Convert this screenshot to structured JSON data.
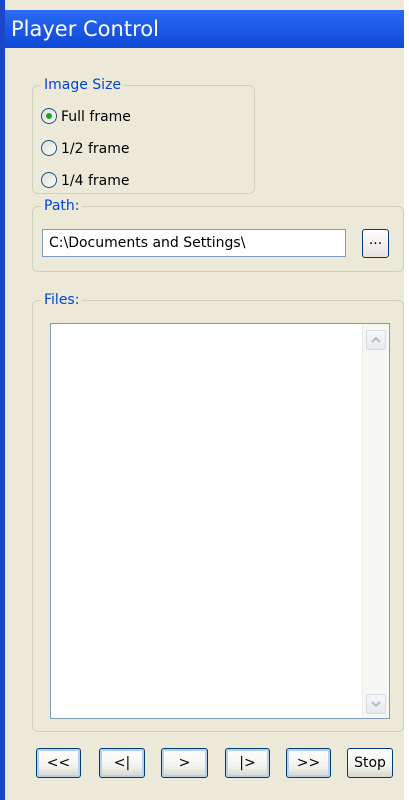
{
  "window": {
    "title": "Player Control"
  },
  "image_size": {
    "legend": "Image Size",
    "options": [
      {
        "label": "Full frame",
        "checked": true
      },
      {
        "label": "1/2 frame",
        "checked": false
      },
      {
        "label": "1/4 frame",
        "checked": false
      }
    ]
  },
  "path": {
    "legend": "Path:",
    "value": "C:\\Documents and Settings\\",
    "browse_label": "..."
  },
  "files": {
    "legend": "Files:",
    "items": []
  },
  "controls": {
    "first": "<<",
    "prev": "<|",
    "play": ">",
    "next": "|>",
    "last": ">>",
    "stop": "Stop"
  },
  "colors": {
    "titlebar": "#1d5ae6",
    "panel_bg": "#ece9d8",
    "legend_text": "#0046d5",
    "selected_radio": "#21a121"
  }
}
